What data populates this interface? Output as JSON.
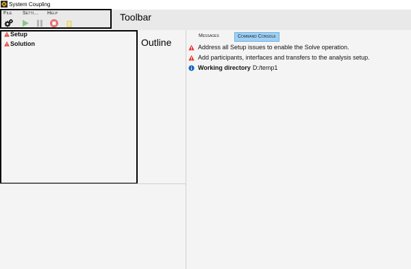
{
  "window": {
    "title": "System Coupling"
  },
  "menu": {
    "file": "File",
    "settings": "Setti...",
    "help": "Help"
  },
  "toolbar": {
    "icons": [
      "gear-icon",
      "play-icon",
      "pause-icon",
      "stop-icon",
      "interrupt-icon"
    ]
  },
  "annotations": {
    "toolbar": "Toolbar",
    "outline": "Outline"
  },
  "outline": {
    "items": [
      {
        "label": "Setup",
        "icon": "warning-icon"
      },
      {
        "label": "Solution",
        "icon": "warning-icon"
      }
    ]
  },
  "tabs": [
    {
      "label": "Messages",
      "active": false
    },
    {
      "label": "Command Console",
      "active": true
    }
  ],
  "messages": [
    {
      "icon": "warning-icon",
      "text": "Address all Setup issues to enable the Solve operation."
    },
    {
      "icon": "warning-icon",
      "text": "Add participants, interfaces and transfers to the analysis setup."
    },
    {
      "icon": "info-icon",
      "bold": "Working directory",
      "text": "D:/temp1"
    }
  ],
  "colors": {
    "warning": "#e53935",
    "info": "#1565c0",
    "active_tab": "#9fd0f5",
    "play": "#8bc58b",
    "stop": "#e57373"
  }
}
